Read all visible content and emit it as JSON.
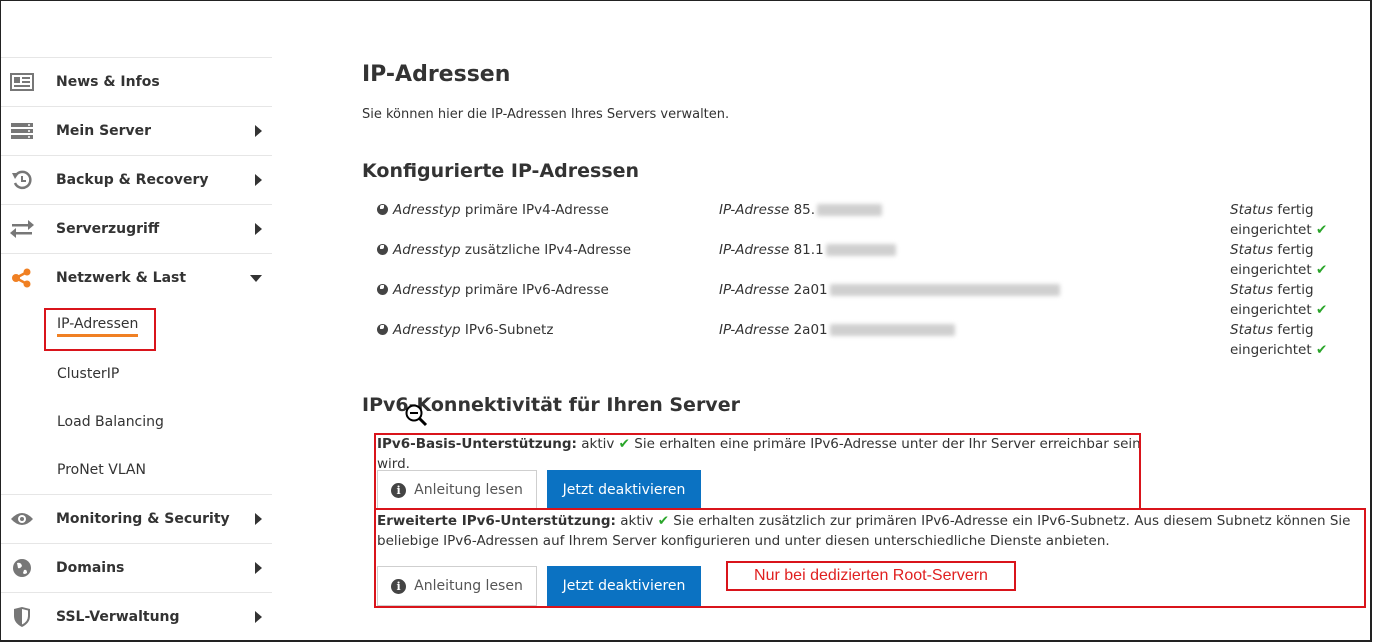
{
  "sidebar": {
    "items": [
      {
        "label": "News & Infos",
        "icon": "newspaper-icon",
        "arrow": "none"
      },
      {
        "label": "Mein Server",
        "icon": "server-icon",
        "arrow": "right"
      },
      {
        "label": "Backup & Recovery",
        "icon": "history-icon",
        "arrow": "right"
      },
      {
        "label": "Serverzugriff",
        "icon": "transfer-arrows-icon",
        "arrow": "right"
      },
      {
        "label": "Netzwerk & Last",
        "icon": "share-nodes-icon",
        "arrow": "down"
      }
    ],
    "subitems": [
      "IP-Adressen",
      "ClusterIP",
      "Load Balancing",
      "ProNet VLAN"
    ],
    "items_after": [
      {
        "label": "Monitoring & Security",
        "icon": "eye-icon",
        "arrow": "right"
      },
      {
        "label": "Domains",
        "icon": "globe-icon",
        "arrow": "right"
      },
      {
        "label": "SSL-Verwaltung",
        "icon": "shield-icon",
        "arrow": "right"
      }
    ]
  },
  "main": {
    "title": "IP-Adressen",
    "intro": "Sie können hier die IP-Adressen Ihres Servers verwalten.",
    "configured_heading": "Konfigurierte IP-Adressen",
    "type_label": "Adresstyp",
    "ip_label": "IP-Adresse",
    "status_label": "Status",
    "rows": [
      {
        "type": "primäre IPv4-Adresse",
        "ip_prefix": "85.",
        "status": "fertig eingerichtet"
      },
      {
        "type": "zusätzliche IPv4-Adresse",
        "ip_prefix": "81.1",
        "status": "fertig eingerichtet"
      },
      {
        "type": "primäre IPv6-Adresse",
        "ip_prefix": "2a01",
        "status": "fertig eingerichtet"
      },
      {
        "type": "IPv6-Subnetz",
        "ip_prefix": "2a01",
        "status": "fertig eingerichtet"
      }
    ],
    "ipv6_heading": "IPv6-Konnektivität für Ihren Server",
    "basic": {
      "title": "IPv6-Basis-Unterstützung:",
      "state": "aktiv",
      "text": "Sie erhalten eine primäre IPv6-Adresse unter der Ihr Server erreichbar sein wird."
    },
    "extended": {
      "title": "Erweiterte IPv6-Unterstützung:",
      "state": "aktiv",
      "text": "Sie erhalten zusätzlich zur primären IPv6-Adresse ein IPv6-Subnetz. Aus diesem Subnetz können Sie beliebige IPv6-Adressen auf Ihrem Server konfigurieren und unter diesen unterschiedliche Dienste anbieten."
    },
    "guide_button": "Anleitung lesen",
    "deactivate_button": "Jetzt deaktivieren",
    "annotation": "Nur bei dedizierten Root-Servern"
  },
  "colors": {
    "accent_orange": "#f08023",
    "button_blue": "#0b72c2",
    "annotation_red": "#d9141b",
    "check_green": "#2aa52a"
  }
}
